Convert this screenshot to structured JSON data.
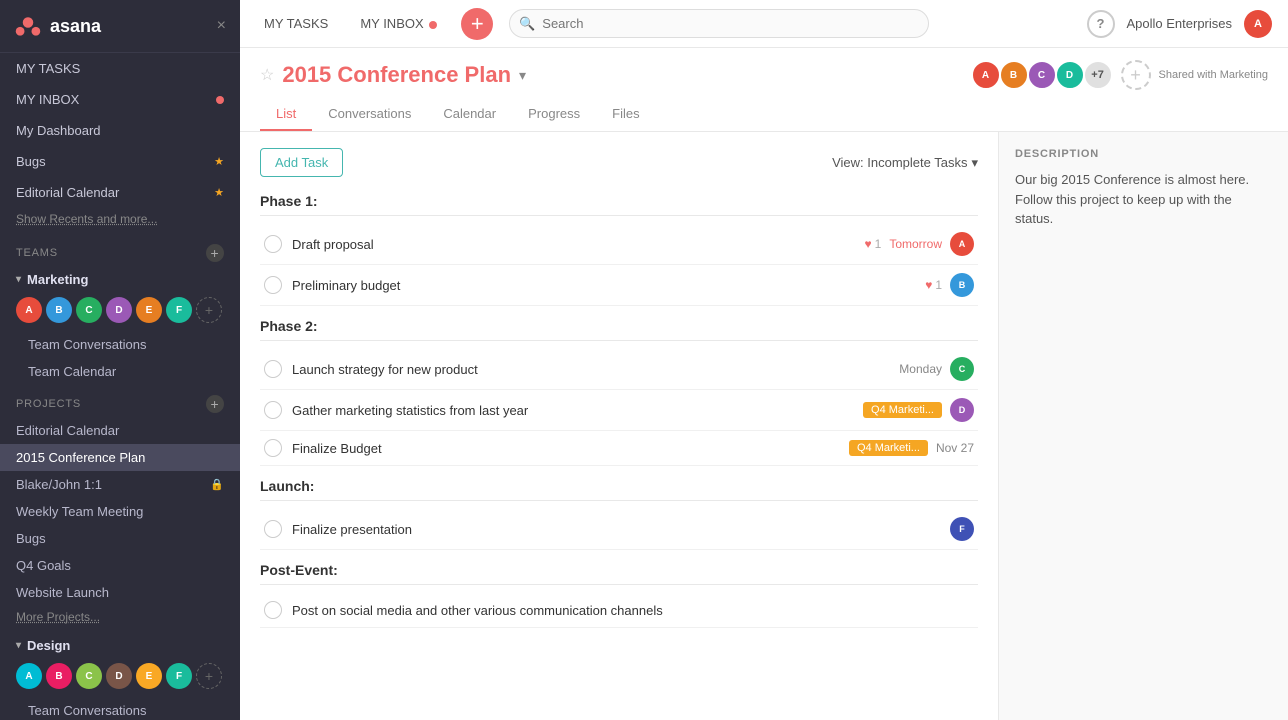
{
  "sidebar": {
    "logo_text": "asana",
    "close_label": "×",
    "nav": {
      "my_tasks": "MY TASKS",
      "my_inbox": "MY INBOX"
    },
    "starred": [
      {
        "label": "My Dashboard"
      },
      {
        "label": "Bugs",
        "starred": true
      },
      {
        "label": "Editorial Calendar",
        "starred": true
      }
    ],
    "show_recents": "Show Recents and more...",
    "teams_section": "Teams",
    "teams": [
      {
        "name": "Marketing",
        "sub_items": [
          "Team Conversations",
          "Team Calendar"
        ],
        "avatars": [
          "AV1",
          "AV2",
          "AV3",
          "AV4",
          "AV5",
          "AV6"
        ]
      }
    ],
    "projects_section": "PROJECTS",
    "projects": [
      {
        "label": "Editorial Calendar",
        "active": false
      },
      {
        "label": "2015 Conference Plan",
        "active": true
      },
      {
        "label": "Blake/John 1:1",
        "active": false,
        "locked": true
      },
      {
        "label": "Weekly Team Meeting",
        "active": false
      },
      {
        "label": "Bugs",
        "active": false
      },
      {
        "label": "Q4 Goals",
        "active": false
      },
      {
        "label": "Website Launch",
        "active": false
      }
    ],
    "more_projects": "More Projects...",
    "design_team": {
      "name": "Design",
      "sub_items": [
        "Team Conversations"
      ],
      "avatars": [
        "D1",
        "D2",
        "D3",
        "D4",
        "D5",
        "D6"
      ]
    }
  },
  "topbar": {
    "my_tasks": "MY TASKS",
    "my_inbox": "MY INBOX",
    "search_placeholder": "Search",
    "help_label": "?",
    "org_name": "Apollo Enterprises"
  },
  "project": {
    "title": "2015 Conference Plan",
    "tabs": [
      "List",
      "Conversations",
      "Calendar",
      "Progress",
      "Files"
    ],
    "active_tab": "List",
    "shared_label": "Shared with Marketing",
    "members_count": "+7"
  },
  "toolbar": {
    "add_task_label": "Add Task",
    "view_filter": "View: Incomplete Tasks"
  },
  "phases": [
    {
      "label": "Phase 1:",
      "tasks": [
        {
          "name": "Draft proposal",
          "likes": "1",
          "due": "Tomorrow",
          "due_urgent": true,
          "tag": null,
          "avatar_color": "av-red"
        },
        {
          "name": "Preliminary budget",
          "likes": "1",
          "due": null,
          "due_urgent": false,
          "tag": null,
          "avatar_color": "av-blue"
        }
      ]
    },
    {
      "label": "Phase 2:",
      "tasks": [
        {
          "name": "Launch strategy for new product",
          "likes": null,
          "due": "Monday",
          "due_urgent": false,
          "tag": null,
          "avatar_color": "av-green"
        },
        {
          "name": "Gather marketing statistics from last year",
          "likes": null,
          "due": null,
          "due_urgent": false,
          "tag": "Q4 Marketi...",
          "tag_color": "orange",
          "avatar_color": "av-purple"
        },
        {
          "name": "Finalize Budget",
          "likes": null,
          "due": "Nov 27",
          "due_urgent": false,
          "tag": "Q4 Marketi...",
          "tag_color": "orange",
          "avatar_color": null
        }
      ]
    },
    {
      "label": "Launch:",
      "tasks": [
        {
          "name": "Finalize presentation",
          "likes": null,
          "due": null,
          "due_urgent": false,
          "tag": null,
          "avatar_color": "av-indigo"
        }
      ]
    },
    {
      "label": "Post-Event:",
      "tasks": [
        {
          "name": "Post on social media and other various communication channels",
          "likes": null,
          "due": null,
          "due_urgent": false,
          "tag": null,
          "avatar_color": null
        }
      ]
    }
  ],
  "description": {
    "title": "DESCRIPTION",
    "text": "Our big 2015 Conference is almost here. Follow this project to keep up with the status."
  }
}
